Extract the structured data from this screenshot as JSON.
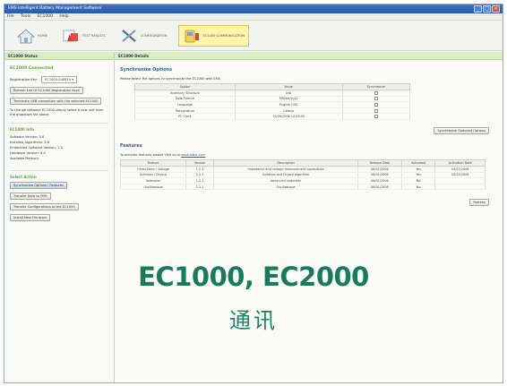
{
  "window": {
    "title": "EMS Intelligent Battery Management Software",
    "controls": [
      "_",
      "□",
      "×"
    ]
  },
  "menu": [
    "File",
    "Tools",
    "EC1000",
    "Help"
  ],
  "toolbar": {
    "items": [
      {
        "label": "HOME",
        "icon": "home-icon"
      },
      {
        "label": "TEST RESULTS",
        "icon": "test-results-icon"
      },
      {
        "label": "CONFIGURATION",
        "icon": "configuration-icon"
      },
      {
        "label": "EC1000 COMMUNICATION",
        "icon": "ec1000-communication-icon"
      }
    ]
  },
  "left": {
    "header": "EC1000 Status",
    "connected": "EC1000 Connected",
    "registration_label": "Registration Key:",
    "registration_value": "EC1000-040810",
    "refresh_btn": "Refresh List Of EC1000 Registration Keys",
    "terminate_btn": "Terminate USB connection with the selected EC1000",
    "change_note": "To change between EC1000 simply select a new unit from the dropdown list above.",
    "info_header": "EC1000 Info",
    "info": [
      "Software Version: 3.0",
      "Installed Algorithms: 3.6",
      "Embedded Software Version: 1.3",
      "Hardware Version: 4.0",
      "Available Memory:"
    ],
    "actions_header": "Select Action",
    "actions": [
      "Synchronize Options / Features",
      "Transfer Data to EMS",
      "Transfer Configurations to the EC1000",
      "Install New Firmware"
    ]
  },
  "right": {
    "header": "EC1000 Details",
    "sync_title": "Synchronize Options",
    "sync_desc": "Please select the options to synchronize the EC1000 with EMS",
    "sync_columns": [
      "Option",
      "Value",
      "Synchronize"
    ],
    "sync_rows": [
      [
        "Inventory Structure",
        "N/A"
      ],
      [
        "Date Format",
        "MM/dd/yyyy"
      ],
      [
        "Language",
        "English (US)"
      ],
      [
        "Temperature",
        "Celsius"
      ],
      [
        "PC Clock",
        "10/26/2006 12:08:05"
      ]
    ],
    "sync_btn": "Synchronize Selected Options",
    "features_title": "Features",
    "features_desc_pre": "To activate features please visit us at ",
    "features_link": "www.alber.com",
    "features_columns": [
      "Feature",
      "Version",
      "Description",
      "Release Date",
      "Activated",
      "Activation Date"
    ],
    "features_rows": [
      [
        "Ohms Dahn / Voltage",
        "1.2.1",
        "Impedance and voltage measurement capabilities",
        "06/01/2006",
        "Yes",
        "04/25/2006"
      ],
      [
        "Sulfation / Dryout",
        "1.2.1",
        "Sulfation and Dryout algorithm",
        "06/01/2006",
        "Yes",
        "04/25/2006"
      ],
      [
        "Voltmeter",
        "1.2.1",
        "Advanced voltmeter",
        "06/01/2006",
        "No",
        ""
      ],
      [
        "Oscilloscope",
        "1.2.1",
        "Oscilloscope",
        "06/01/2006",
        "No",
        ""
      ]
    ],
    "refresh_btn": "Refresh"
  },
  "overlay": {
    "title": "EC1000, EC2000",
    "subtitle": "通讯"
  },
  "colors": {
    "accent_green": "#6aa542",
    "overlay_teal": "#1a7a5e",
    "titlebar_blue": "#2a5aa8",
    "active_tool": "#fff5a8"
  }
}
